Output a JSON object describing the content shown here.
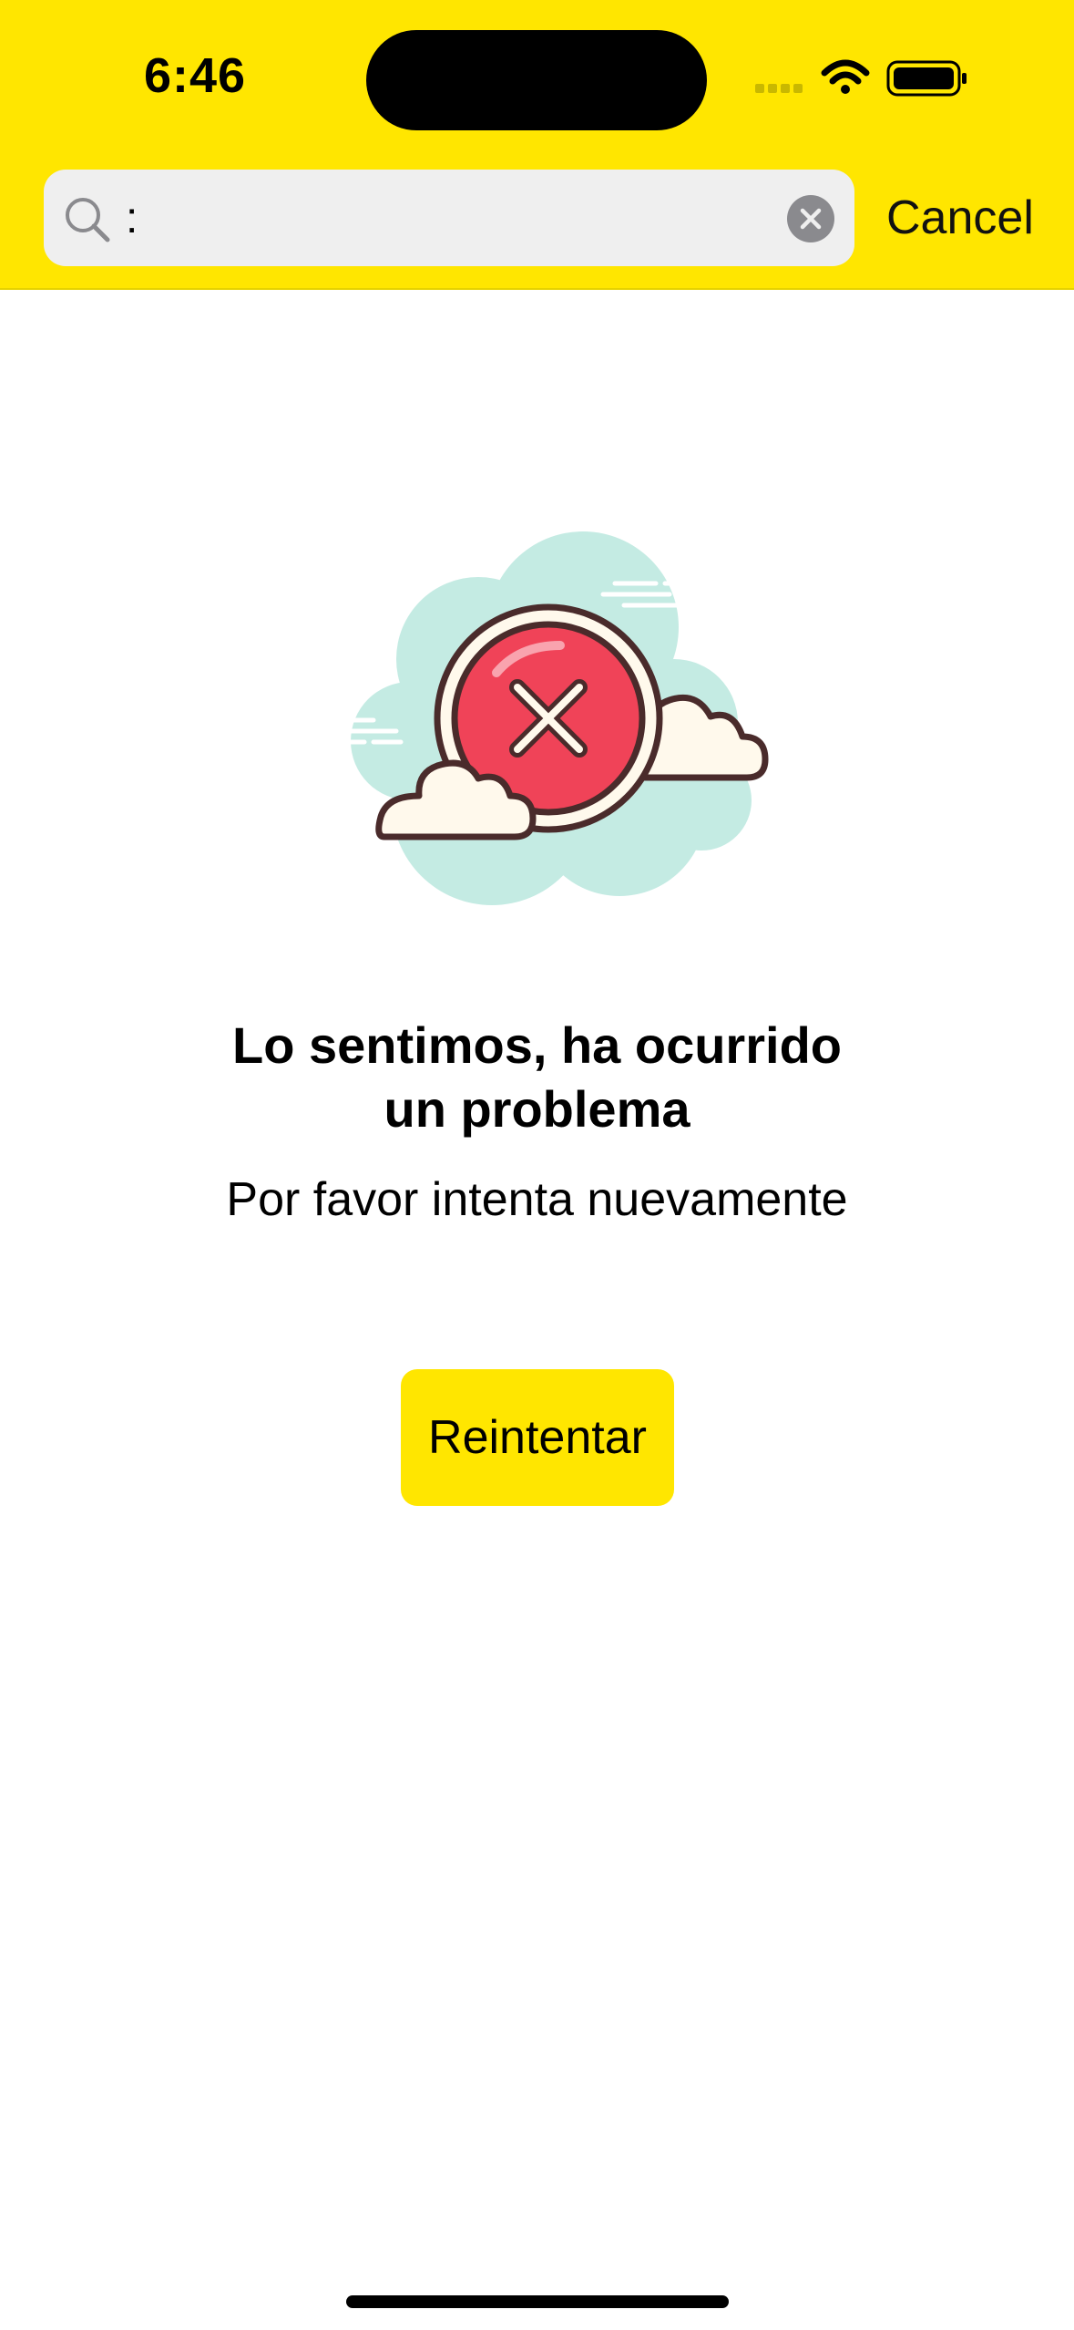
{
  "status_bar": {
    "time": "6:46"
  },
  "search": {
    "query": ":",
    "cancel_label": "Cancel"
  },
  "error": {
    "title_line1": "Lo sentimos, ha ocurrido",
    "title_line2": "un problema",
    "subtitle": "Por favor intenta nuevamente",
    "retry_label": "Reintentar"
  },
  "icons": {
    "search": "search-icon",
    "clear": "clear-icon",
    "error": "error-cloud-illustration"
  },
  "colors": {
    "brand_yellow": "#FFE600",
    "error_red": "#F04358",
    "cloud_teal": "#C4EBE3"
  }
}
